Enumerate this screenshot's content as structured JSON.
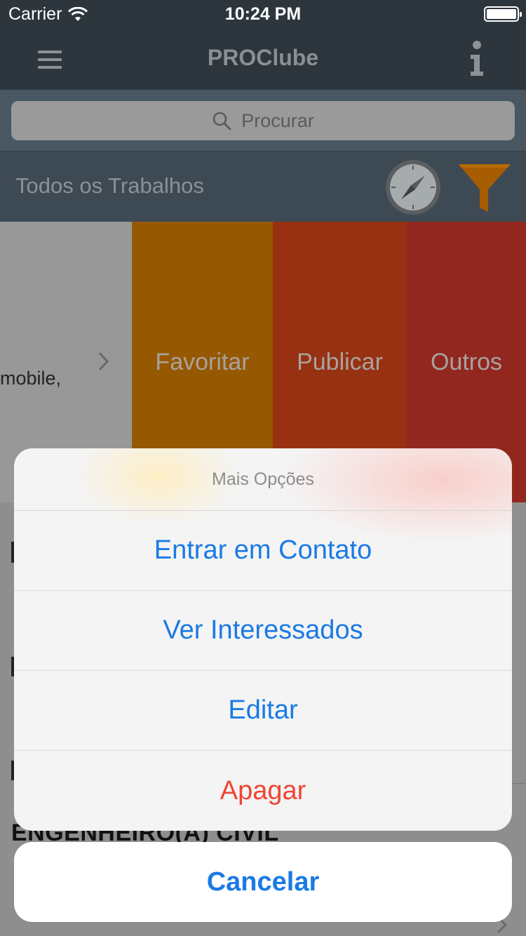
{
  "status_bar": {
    "carrier": "Carrier",
    "time": "10:24 PM"
  },
  "nav": {
    "title": "PROClube",
    "left_icon": "hamburger-menu-icon",
    "right_icon": "info-icon"
  },
  "search": {
    "placeholder": "Procurar",
    "icon": "search-icon"
  },
  "filter": {
    "title": "Todos os Trabalhos",
    "icons": [
      "compass-icon",
      "funnel-icon"
    ]
  },
  "list": {
    "row1_snippet": "mobile,",
    "swipe_actions": [
      {
        "label": "Favoritar",
        "color": "#965800"
      },
      {
        "label": "Publicar",
        "color": "#973112"
      },
      {
        "label": "Outros",
        "color": "#922720"
      }
    ],
    "row2_title": "ENGENHEIRO(A) CIVIL"
  },
  "action_sheet": {
    "title": "Mais Opções",
    "options": [
      {
        "label": "Entrar em Contato",
        "style": "default"
      },
      {
        "label": "Ver Interessados",
        "style": "default"
      },
      {
        "label": "Editar",
        "style": "default"
      },
      {
        "label": "Apagar",
        "style": "destructive"
      }
    ],
    "cancel": "Cancelar"
  },
  "colors": {
    "accent": "#1a7ae6",
    "destructive": "#f04534",
    "navbar": "#2d363d"
  }
}
